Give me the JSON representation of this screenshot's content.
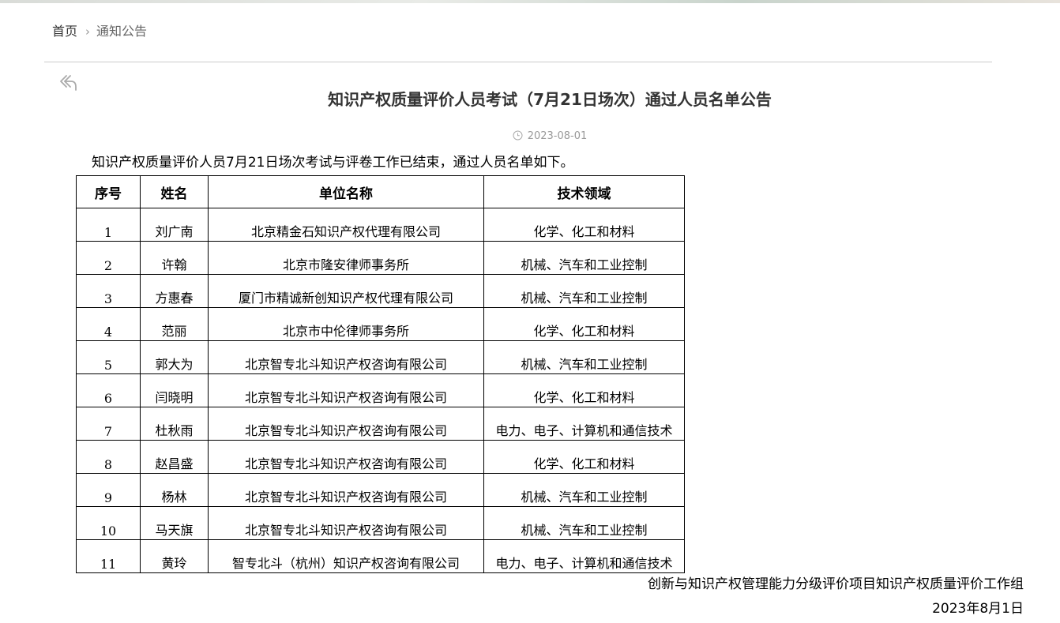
{
  "breadcrumb": {
    "home": "首页",
    "separator": "›",
    "current": "通知公告"
  },
  "icons": {
    "back": "reply-arrow-icon",
    "date": "clock-icon",
    "breadcrumb_separator": "chevron-right-icon"
  },
  "article": {
    "title": "知识产权质量评价人员考试（7月21日场次）通过人员名单公告",
    "date": "2023-08-01",
    "intro": "知识产权质量评价人员7月21日场次考试与评卷工作已结束，通过人员名单如下。"
  },
  "table": {
    "headers": {
      "no": "序号",
      "name": "姓名",
      "org": "单位名称",
      "field": "技术领域"
    },
    "rows": [
      {
        "no": "1",
        "name": "刘广南",
        "org": "北京精金石知识产权代理有限公司",
        "field": "化学、化工和材料"
      },
      {
        "no": "2",
        "name": "许翰",
        "org": "北京市隆安律师事务所",
        "field": "机械、汽车和工业控制"
      },
      {
        "no": "3",
        "name": "方惠春",
        "org": "厦门市精诚新创知识产权代理有限公司",
        "field": "机械、汽车和工业控制"
      },
      {
        "no": "4",
        "name": "范丽",
        "org": "北京市中伦律师事务所",
        "field": "化学、化工和材料"
      },
      {
        "no": "5",
        "name": "郭大为",
        "org": "北京智专北斗知识产权咨询有限公司",
        "field": "机械、汽车和工业控制"
      },
      {
        "no": "6",
        "name": "闫晓明",
        "org": "北京智专北斗知识产权咨询有限公司",
        "field": "化学、化工和材料"
      },
      {
        "no": "7",
        "name": "杜秋雨",
        "org": "北京智专北斗知识产权咨询有限公司",
        "field": "电力、电子、计算机和通信技术"
      },
      {
        "no": "8",
        "name": "赵昌盛",
        "org": "北京智专北斗知识产权咨询有限公司",
        "field": "化学、化工和材料"
      },
      {
        "no": "9",
        "name": "杨林",
        "org": "北京智专北斗知识产权咨询有限公司",
        "field": "机械、汽车和工业控制"
      },
      {
        "no": "10",
        "name": "马天旗",
        "org": "北京智专北斗知识产权咨询有限公司",
        "field": "机械、汽车和工业控制"
      },
      {
        "no": "11",
        "name": "黄玲",
        "org": "智专北斗（杭州）知识产权咨询有限公司",
        "field": "电力、电子、计算机和通信技术"
      }
    ]
  },
  "signature": {
    "org": "创新与知识产权管理能力分级评价项目知识产权质量评价工作组",
    "date": "2023年8月1日"
  }
}
